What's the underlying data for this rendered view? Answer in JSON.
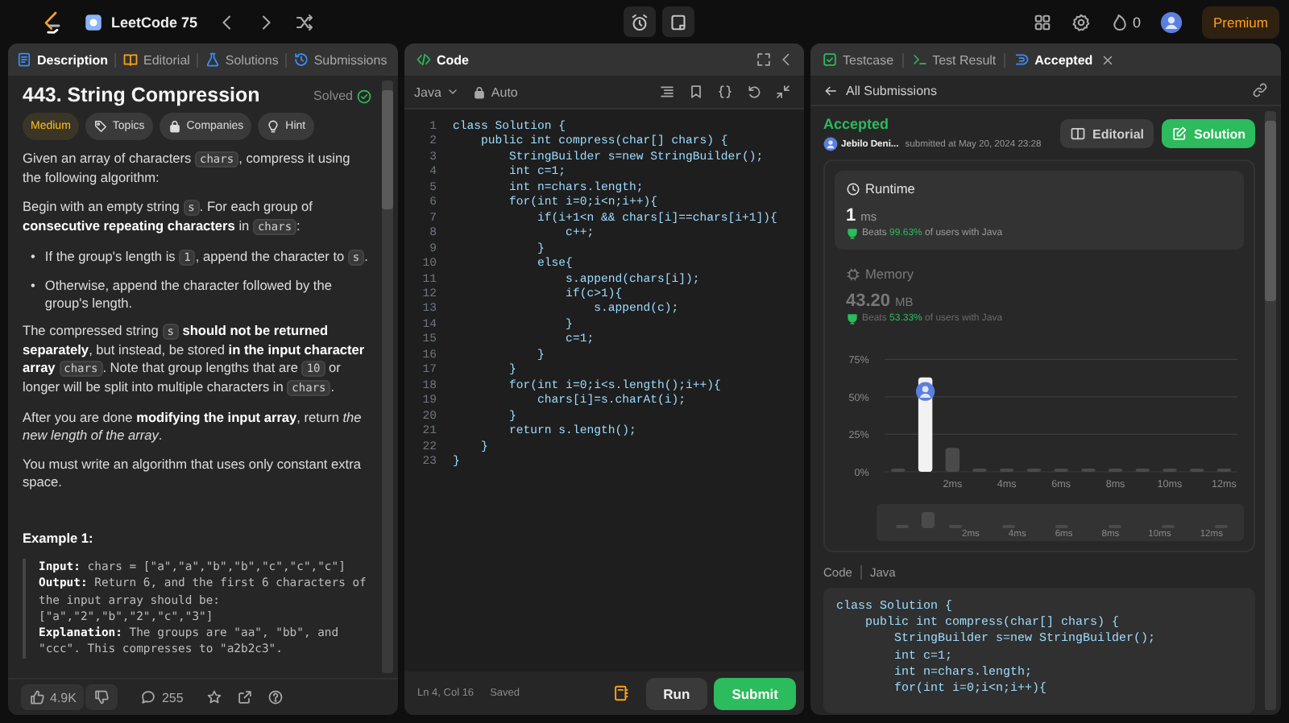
{
  "topbar": {
    "title": "LeetCode 75",
    "streak": "0",
    "premium": "Premium"
  },
  "description": {
    "tabs": [
      {
        "label": "Description",
        "selected": true,
        "kind": "description"
      },
      {
        "label": "Editorial",
        "selected": false,
        "kind": "editorial"
      },
      {
        "label": "Solutions",
        "selected": false,
        "kind": "solutions"
      },
      {
        "label": "Submissions",
        "selected": false,
        "kind": "submissions"
      }
    ],
    "title": "443. String Compression",
    "status": "Solved",
    "tags": [
      {
        "label": "Medium",
        "kind": "difficulty"
      },
      {
        "label": "Topics",
        "kind": "topics"
      },
      {
        "label": "Companies",
        "kind": "companies"
      },
      {
        "label": "Hint",
        "kind": "hint"
      }
    ],
    "paragraphs": [
      {
        "kind": "text",
        "segments": [
          {
            "kind": "text",
            "text": "Given an array of characters "
          },
          {
            "kind": "code",
            "text": "chars"
          },
          {
            "kind": "text",
            "text": ", compress it using the following algorithm:"
          }
        ]
      },
      {
        "kind": "text",
        "segments": [
          {
            "kind": "text",
            "text": "Begin with an empty string "
          },
          {
            "kind": "code",
            "text": "s"
          },
          {
            "kind": "text",
            "text": ". For each group of "
          },
          {
            "kind": "bold",
            "text": "consecutive repeating characters"
          },
          {
            "kind": "text",
            "text": " in "
          },
          {
            "kind": "code",
            "text": "chars"
          },
          {
            "kind": "text",
            "text": ":"
          }
        ]
      },
      {
        "kind": "bullet",
        "marker": "•",
        "segments": [
          {
            "kind": "text",
            "text": "If the group's length is "
          },
          {
            "kind": "code",
            "text": "1"
          },
          {
            "kind": "text",
            "text": ", append the character to "
          },
          {
            "kind": "code",
            "text": "s"
          },
          {
            "kind": "text",
            "text": "."
          }
        ]
      },
      {
        "kind": "bullet",
        "marker": "•",
        "segments": [
          {
            "kind": "text",
            "text": "Otherwise, append the character followed by the group's length."
          }
        ]
      },
      {
        "kind": "text",
        "segments": [
          {
            "kind": "text",
            "text": "The compressed string "
          },
          {
            "kind": "code",
            "text": "s"
          },
          {
            "kind": "bold",
            "text": " should not be returned separately"
          },
          {
            "kind": "text",
            "text": ", but instead, be stored "
          },
          {
            "kind": "bold",
            "text": "in the input character array "
          },
          {
            "kind": "code",
            "text": "chars"
          },
          {
            "kind": "text",
            "text": ". Note that group lengths that are "
          },
          {
            "kind": "code",
            "text": "10"
          },
          {
            "kind": "text",
            "text": " or longer will be split into multiple characters in "
          },
          {
            "kind": "code",
            "text": "chars"
          },
          {
            "kind": "text",
            "text": "."
          }
        ]
      },
      {
        "kind": "text",
        "segments": [
          {
            "kind": "text",
            "text": "After you are done "
          },
          {
            "kind": "bold",
            "text": "modifying the input array"
          },
          {
            "kind": "text",
            "text": ", return "
          },
          {
            "kind": "italic",
            "text": "the new length of the array"
          },
          {
            "kind": "text",
            "text": "."
          }
        ]
      },
      {
        "kind": "text",
        "segments": [
          {
            "kind": "text",
            "text": "You must write an algorithm that uses only constant extra space."
          }
        ]
      }
    ],
    "example_title": "Example 1:",
    "example_lines": [
      "**Input:** chars = [\"a\",\"a\",\"b\",\"b\",\"c\",\"c\",\"c\"]",
      "**Output:** Return 6, and the first 6 characters of the input array should be: [\"a\",\"2\",\"b\",\"2\",\"c\",\"3\"]",
      "**Explanation:** The groups are \"aa\", \"bb\", and \"ccc\". This compresses to \"a2b2c3\"."
    ],
    "likes": "4.9K",
    "comments": "255"
  },
  "editor": {
    "title": "Code",
    "language": "Java",
    "mode": "Auto",
    "lines": [
      {
        "number": "1",
        "code": "class Solution {"
      },
      {
        "number": "2",
        "code": "    public int compress(char[] chars) {"
      },
      {
        "number": "3",
        "code": "        StringBuilder s=new StringBuilder();"
      },
      {
        "number": "4",
        "code": "        int c=1;"
      },
      {
        "number": "5",
        "code": "        int n=chars.length;"
      },
      {
        "number": "6",
        "code": "        for(int i=0;i<n;i++){"
      },
      {
        "number": "7",
        "code": "            if(i+1<n && chars[i]==chars[i+1]){"
      },
      {
        "number": "8",
        "code": "                c++;"
      },
      {
        "number": "9",
        "code": "            }"
      },
      {
        "number": "10",
        "code": "            else{"
      },
      {
        "number": "11",
        "code": "                s.append(chars[i]);"
      },
      {
        "number": "12",
        "code": "                if(c>1){"
      },
      {
        "number": "13",
        "code": "                    s.append(c);"
      },
      {
        "number": "14",
        "code": "                }"
      },
      {
        "number": "15",
        "code": "                c=1;"
      },
      {
        "number": "16",
        "code": "            }"
      },
      {
        "number": "17",
        "code": "        }"
      },
      {
        "number": "18",
        "code": "        for(int i=0;i<s.length();i++){"
      },
      {
        "number": "19",
        "code": "            chars[i]=s.charAt(i);"
      },
      {
        "number": "20",
        "code": "        }"
      },
      {
        "number": "21",
        "code": "        return s.length();"
      },
      {
        "number": "22",
        "code": "    }"
      },
      {
        "number": "23",
        "code": "}"
      }
    ],
    "cursor": "Ln 4, Col 16",
    "save_state": "Saved",
    "run": "Run",
    "submit": "Submit"
  },
  "result": {
    "tabs": [
      {
        "label": "Testcase",
        "selected": false,
        "closable": false,
        "kind": "testcase"
      },
      {
        "label": "Test Result",
        "selected": false,
        "closable": false,
        "kind": "result"
      },
      {
        "label": "Accepted",
        "selected": true,
        "closable": true,
        "kind": "accepted"
      }
    ],
    "back": "All Submissions",
    "verdict": "Accepted",
    "user": "Jebilo Deni...",
    "submitted": "submitted at May 20, 2024 23:28",
    "buttons": [
      {
        "label": "Editorial",
        "kind": "secondary"
      },
      {
        "label": "Solution",
        "kind": "primary"
      }
    ],
    "metrics": [
      {
        "kind": "runtime",
        "label": "Runtime",
        "value": "1",
        "unit": "ms",
        "beats_label": "Beats",
        "beats": "99.63%",
        "suffix": "of users with Java",
        "selected": true
      },
      {
        "kind": "memory",
        "label": "Memory",
        "value": "43.20",
        "unit": "MB",
        "beats_label": "Beats",
        "beats": "53.33%",
        "suffix": "of users with Java",
        "selected": false
      }
    ],
    "chart_data": {
      "type": "bar",
      "x": [
        0,
        1,
        2,
        3,
        4,
        5,
        6,
        7,
        8,
        9,
        10,
        11,
        12
      ],
      "values": [
        1,
        63,
        16,
        1,
        1,
        1,
        1,
        1,
        1,
        1,
        1,
        1,
        1
      ],
      "xlim": [
        -0.5,
        12.5
      ],
      "ylim": [
        0,
        75
      ],
      "yticks": [
        {
          "value": 0,
          "label": "0%"
        },
        {
          "value": 25,
          "label": "25%"
        },
        {
          "value": 50,
          "label": "50%"
        },
        {
          "value": 75,
          "label": "75%"
        }
      ],
      "xticks": [
        {
          "value": 2,
          "label": "2ms"
        },
        {
          "value": 4,
          "label": "4ms"
        },
        {
          "value": 6,
          "label": "6ms"
        },
        {
          "value": 8,
          "label": "8ms"
        },
        {
          "value": 10,
          "label": "10ms"
        },
        {
          "value": 12,
          "label": "12ms"
        }
      ],
      "title": null
    },
    "overview_labels": [
      "2ms",
      "4ms",
      "6ms",
      "8ms",
      "10ms",
      "12ms"
    ],
    "code_label": "Code",
    "code_language": "Java",
    "code_lines": [
      "class Solution {",
      "    public int compress(char[] chars) {",
      "        StringBuilder s=new StringBuilder();",
      "        int c=1;",
      "        int n=chars.length;",
      "        for(int i=0;i<n;i++){"
    ]
  }
}
